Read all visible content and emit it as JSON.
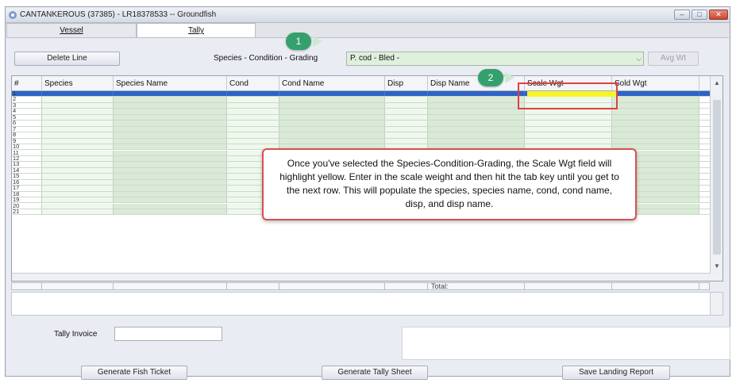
{
  "window": {
    "title": "CANTANKEROUS (37385) - LR18378533 -- Groundfish",
    "controls": [
      "–",
      "□",
      "✕"
    ]
  },
  "tabs": [
    {
      "label": "Vessel",
      "active": false
    },
    {
      "label": "Tally",
      "active": true
    }
  ],
  "toolbar": {
    "delete_label": "Delete Line",
    "scg_label": "Species - Condition - Grading",
    "scg_value": "P. cod - Bled -",
    "avg_wt_label": "Avg Wt"
  },
  "annotations": {
    "badge_1": "1",
    "badge_2": "2",
    "callout": "Once you've selected the Species-Condition-Grading, the Scale Wgt field will highlight yellow. Enter in the scale weight and then hit the tab key until you get to the next row. This will populate the species, species name, cond, cond name, disp, and disp name."
  },
  "grid": {
    "columns": [
      "#",
      "Species",
      "Species Name",
      "Cond",
      "Cond Name",
      "Disp",
      "Disp Name",
      "Scale Wgt",
      "Sold Wgt"
    ],
    "row_numbers": [
      "1",
      "2",
      "3",
      "4",
      "5",
      "6",
      "7",
      "8",
      "9",
      "10",
      "11",
      "12",
      "13",
      "14",
      "15",
      "16",
      "17",
      "18",
      "19",
      "20",
      "21"
    ],
    "selected_row": 1,
    "total_label": "Total:"
  },
  "footer": {
    "tally_invoice_label": "Tally Invoice",
    "tally_invoice_value": "",
    "generate_fish_ticket": "Generate Fish Ticket",
    "generate_tally_sheet": "Generate Tally Sheet",
    "save_landing_report": "Save Landing Report"
  },
  "colors": {
    "selected_row": "#2f63c7",
    "scale_highlight": "#f8f32b",
    "badge": "#35a06e",
    "callout_border": "#d6504e",
    "cell_light": "#eef8ec",
    "cell_dark": "#d9ebd6"
  }
}
